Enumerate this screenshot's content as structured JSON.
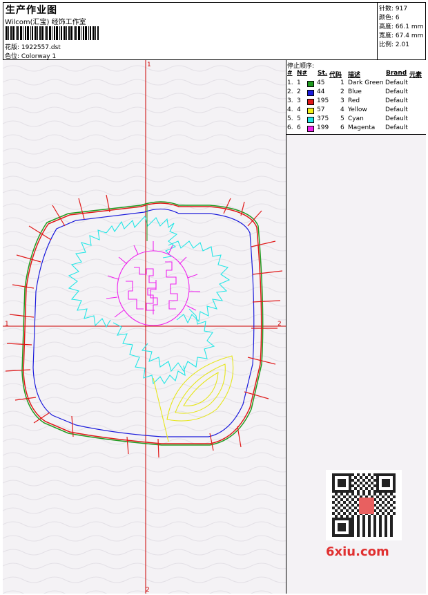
{
  "header": {
    "title": "生产作业图",
    "subtitle": "Wilcom(汇宝) 经饰工作室",
    "design_file_label": "花版:",
    "design_file": "1922557.dst",
    "colorway_label": "色位:",
    "colorway": "Colorway 1"
  },
  "stats": [
    {
      "label": "针数:",
      "value": "917"
    },
    {
      "label": "颜色:",
      "value": "6"
    },
    {
      "label": "高度:",
      "value": "66.1 mm"
    },
    {
      "label": "宽度:",
      "value": "67.4 mm"
    },
    {
      "label": "比例:",
      "value": "2.01"
    }
  ],
  "stop_sequence": {
    "title": "停止顺序:",
    "headers": {
      "num": "#",
      "needle": "N#",
      "stitches": "St.",
      "code": "代码",
      "desc": "描述",
      "brand": "Brand",
      "element": "元素"
    },
    "rows": [
      {
        "num": "1.",
        "needle": "1",
        "color": "#1f9a1f",
        "stitches": "45",
        "code": "1",
        "desc": "Dark Green",
        "brand": "Default"
      },
      {
        "num": "2.",
        "needle": "2",
        "color": "#1a1adb",
        "stitches": "44",
        "code": "2",
        "desc": "Blue",
        "brand": "Default"
      },
      {
        "num": "3.",
        "needle": "3",
        "color": "#e01818",
        "stitches": "195",
        "code": "3",
        "desc": "Red",
        "brand": "Default"
      },
      {
        "num": "4.",
        "needle": "4",
        "color": "#f2f21a",
        "stitches": "57",
        "code": "4",
        "desc": "Yellow",
        "brand": "Default"
      },
      {
        "num": "5.",
        "needle": "5",
        "color": "#22e6e6",
        "stitches": "375",
        "code": "5",
        "desc": "Cyan",
        "brand": "Default"
      },
      {
        "num": "6.",
        "needle": "6",
        "color": "#ee22ee",
        "stitches": "199",
        "code": "6",
        "desc": "Magenta",
        "brand": "Default"
      }
    ]
  },
  "axes": {
    "top": "1",
    "left": "1",
    "right": "2",
    "bottom": "2"
  },
  "watermark": "6xiu.com"
}
